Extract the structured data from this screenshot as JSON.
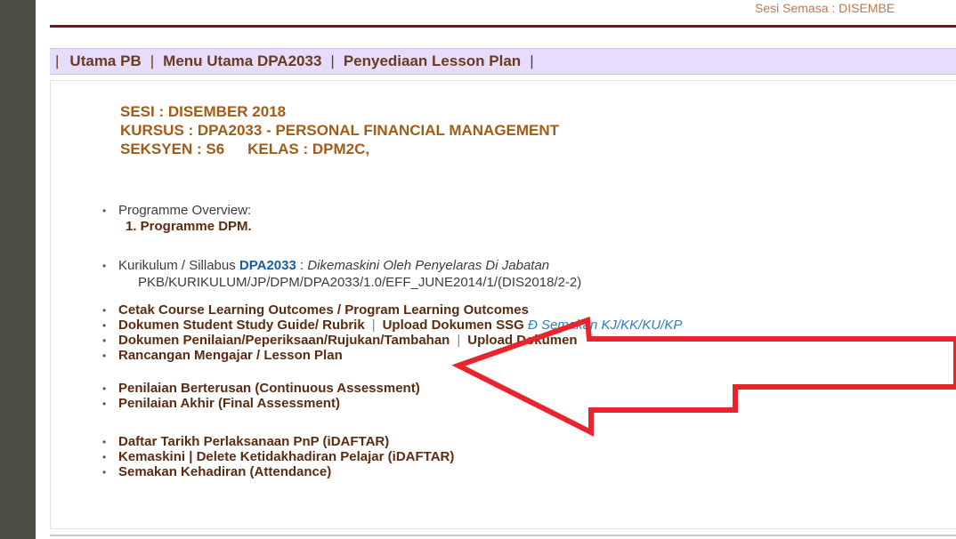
{
  "session_header": "Sesi Semasa : DISEMBE",
  "nav": {
    "sep": "|",
    "items": [
      "Utama PB",
      "Menu Utama DPA2033",
      "Penyediaan Lesson Plan"
    ]
  },
  "course": {
    "sesi": "SESI : DISEMBER 2018",
    "kursus": "KURSUS : DPA2033 - PERSONAL FINANCIAL MANAGEMENT",
    "seksyen": "SEKSYEN : S6",
    "kelas": "KELAS : DPM2C,"
  },
  "menu": {
    "programme_overview": "Programme Overview:",
    "programme_sub": "1. Programme DPM.",
    "kurikulum_prefix": "Kurikulum / Sillabus",
    "kurikulum_code": "DPA2033",
    "kurikulum_colon": ":",
    "kurikulum_note": "Dikemaskini Oleh Penyelaras Di Jabatan",
    "kurikulum_ref": "PKB/KURIKULUM/JP/DPM/DPA2033/1.0/EFF_JUNE2014/1/(DIS2018/2-2)",
    "cetak": "Cetak Course Learning Outcomes / Program Learning Outcomes",
    "ssg_doc": "Dokumen Student Study Guide/ Rubrik",
    "ssg_sep": "|",
    "ssg_upload": "Upload Dokumen SSG",
    "ssg_check": "Đ Semakan KJ/KK/KU/KP",
    "penilaian_doc": "Dokumen Penilaian/Peperiksaan/Rujukan/Tambahan",
    "penilaian_sep": "|",
    "penilaian_upload": "Upload Dokumen",
    "lesson_plan": "Rancangan Mengajar / Lesson Plan",
    "ca": "Penilaian Berterusan (Continuous Assessment)",
    "fa": "Penilaian Akhir (Final Assessment)",
    "daftar": "Daftar Tarikh Perlaksanaan PnP (iDAFTAR)",
    "kemaskini": "Kemaskini | Delete Ketidakhadiran Pelajar (iDAFTAR)",
    "semakan": "Semakan Kehadiran (Attendance)"
  },
  "bullet": "•",
  "annotation_color": "#e8252c"
}
